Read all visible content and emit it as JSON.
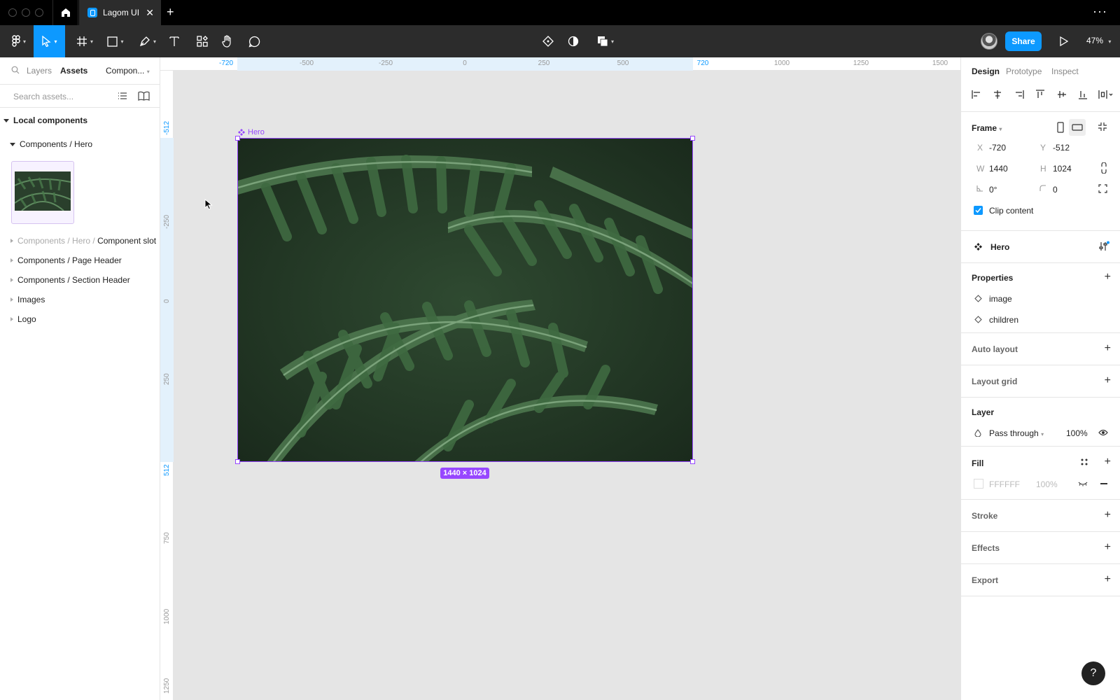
{
  "titlebar": {
    "tab_title": "Lagom UI",
    "close_glyph": "✕",
    "new_tab_glyph": "+",
    "more_glyph": "···"
  },
  "toolbar": {
    "share_label": "Share",
    "zoom_label": "47%",
    "active_tool": "move-tool"
  },
  "left_panel": {
    "tabs": [
      {
        "label": "Layers"
      },
      {
        "label": "Assets"
      },
      {
        "label": "Compon..."
      }
    ],
    "search_placeholder": "Search assets...",
    "local_components_label": "Local components",
    "hero_group_label": "Components / Hero",
    "slot_prefix": "Components / Hero / ",
    "slot_name": "Component slot",
    "groups": [
      {
        "label": "Components / Page Header"
      },
      {
        "label": "Components / Section Header"
      },
      {
        "label": "Images"
      },
      {
        "label": "Logo"
      }
    ]
  },
  "rulers": {
    "top": [
      {
        "label": "-720",
        "selected": true
      },
      {
        "label": "-500",
        "selected": false
      },
      {
        "label": "-250",
        "selected": false
      },
      {
        "label": "0",
        "selected": false
      },
      {
        "label": "250",
        "selected": false
      },
      {
        "label": "500",
        "selected": false
      },
      {
        "label": "720",
        "selected": true
      },
      {
        "label": "1000",
        "selected": false
      },
      {
        "label": "1250",
        "selected": false
      },
      {
        "label": "1500",
        "selected": false
      }
    ],
    "left": [
      {
        "label": "-512",
        "selected": true
      },
      {
        "label": "-250",
        "selected": false
      },
      {
        "label": "0",
        "selected": false
      },
      {
        "label": "250",
        "selected": false
      },
      {
        "label": "512",
        "selected": true
      },
      {
        "label": "750",
        "selected": false
      },
      {
        "label": "1000",
        "selected": false
      },
      {
        "label": "1250",
        "selected": false
      }
    ]
  },
  "canvas": {
    "frame_name": "Hero",
    "dimension_badge": "1440 × 1024",
    "selection_color": "#9747ff"
  },
  "right_panel": {
    "tabs": [
      {
        "label": "Design"
      },
      {
        "label": "Prototype"
      },
      {
        "label": "Inspect"
      }
    ],
    "frame_label": "Frame",
    "x_label": "X",
    "x_value": "-720",
    "y_label": "Y",
    "y_value": "-512",
    "w_label": "W",
    "w_value": "1440",
    "h_label": "H",
    "h_value": "1024",
    "rotation_value": "0°",
    "radius_value": "0",
    "clip_content_label": "Clip content",
    "clip_content_checked": true,
    "component_name": "Hero",
    "properties_title": "Properties",
    "properties": [
      {
        "label": "image"
      },
      {
        "label": "children"
      }
    ],
    "auto_layout_title": "Auto layout",
    "layout_grid_title": "Layout grid",
    "layer_title": "Layer",
    "blend_mode": "Pass through",
    "layer_opacity": "100%",
    "fill_title": "Fill",
    "fill_hex": "FFFFFF",
    "fill_opacity": "100%",
    "stroke_title": "Stroke",
    "effects_title": "Effects",
    "export_title": "Export"
  },
  "help": {
    "glyph": "?"
  },
  "colors": {
    "accent": "#0d99ff",
    "component_purple": "#9747ff",
    "toolbar_bg": "#2c2c2c"
  }
}
